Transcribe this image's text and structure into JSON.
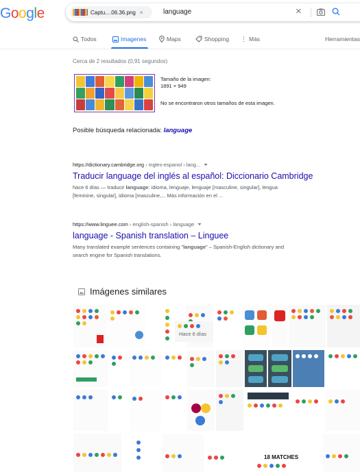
{
  "header": {
    "logo": [
      "G",
      "o",
      "o",
      "g",
      "l",
      "e"
    ],
    "logo_colors": [
      "#4285f4",
      "#ea4335",
      "#fbbc05",
      "#4285f4",
      "#34a853",
      "#ea4335"
    ],
    "chip_label": "Captu....06.36.png",
    "chip_close": "×",
    "query": "language",
    "clear": "×"
  },
  "tabs": {
    "all": "Todos",
    "images": "Imagenes",
    "maps": "Maps",
    "shopping": "Shopping",
    "more": "Más",
    "tools": "Herramientas"
  },
  "result_stats": "Cerca de 2 resultados (0,91 segundos)",
  "query_image": {
    "size_label": "Tamaño de la imagen:",
    "size_value": "1891 × 949",
    "no_other_sizes": "No se encontraron otros tamaños de esta imagen."
  },
  "related": {
    "label": "Posible búsqueda relacionada: ",
    "link": "language"
  },
  "results": [
    {
      "domain": "https://dictionary.cambridge.org",
      "path": " › ingles-espanol › lang...",
      "title": "Traducir language del inglés al español: Diccionario Cambridge",
      "snippet_1a": "hace 6 días — traducir ",
      "snippet_1b": "language",
      "snippet_1c": ": idioma, lenguaje, lenguaje [masculine, singular], lengua",
      "snippet_2": "[feminine, singular], idioma [masculine,... Más información en el ..."
    },
    {
      "domain": "https://www.linguee.com",
      "path": " › english-spanish › language",
      "title": "language - Spanish translation – Linguee",
      "snippet_1a": "Many translated example sentences containing \"",
      "snippet_1b": "language",
      "snippet_1c": "\" – Spanish-English dictionary and",
      "snippet_2": "search engine for Spanish translations."
    }
  ],
  "similar_images": {
    "heading": "Imágenes similares",
    "tile_text_hace": "Hace 6 días",
    "tile_text_matches": "18 MATCHES"
  }
}
